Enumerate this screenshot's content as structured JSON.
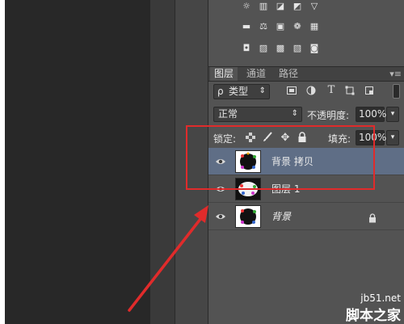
{
  "adjustments": {
    "row1": [
      "☼",
      "▥",
      "◪",
      "◩",
      "▽"
    ],
    "row2": [
      "▬",
      "⚖",
      "▣",
      "❁",
      "▦"
    ],
    "row3": [
      "◘",
      "▨",
      "▩",
      "▧",
      "◙"
    ]
  },
  "tabs": [
    {
      "label": "图层",
      "active": true
    },
    {
      "label": "通道",
      "active": false
    },
    {
      "label": "路径",
      "active": false
    }
  ],
  "panel_menu": "▾≡",
  "filter": {
    "search_glyph": "ρ",
    "kind": "类型",
    "arrow": "⇕"
  },
  "blend": {
    "mode": "正常",
    "arrow": "⇕",
    "opacity_label": "不透明度:",
    "opacity_value": "100%"
  },
  "lock": {
    "label": "锁定:",
    "fill_label": "填充:",
    "fill_value": "100%"
  },
  "layers": [
    {
      "name": "背景 拷贝",
      "selected": true,
      "locked": false
    },
    {
      "name": "图层 1",
      "selected": false,
      "locked": false
    },
    {
      "name": "背景",
      "selected": false,
      "locked": true
    }
  ],
  "watermark": {
    "site": "jb51.net",
    "brand": "脚本之家"
  },
  "colors": {
    "panel": "#535353",
    "selected_row": "#5f6e86",
    "annotation": "#e02b2b"
  }
}
